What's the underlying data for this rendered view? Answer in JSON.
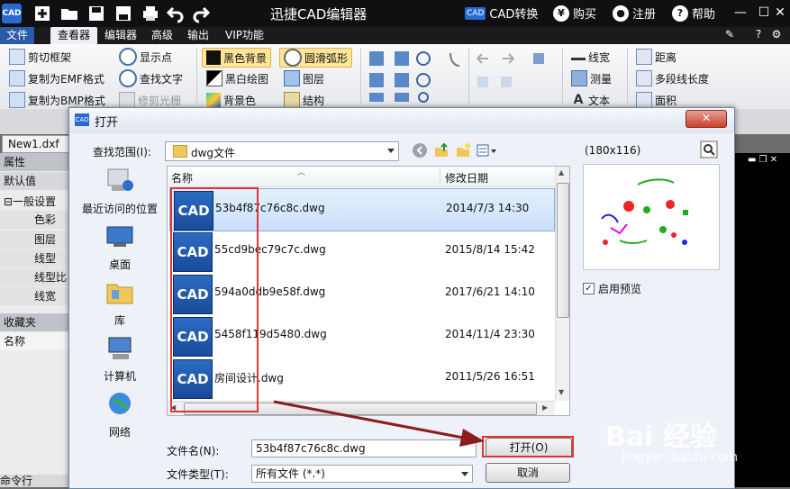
{
  "app": {
    "title": "迅捷CAD编辑器",
    "logo_text": "CAD",
    "top_buttons": [
      {
        "label": "CAD转换",
        "icon": "cad-convert-icon"
      },
      {
        "label": "购买",
        "icon": "yen-icon"
      },
      {
        "label": "注册",
        "icon": "user-icon"
      },
      {
        "label": "帮助",
        "icon": "help-icon"
      }
    ]
  },
  "menu": {
    "items": [
      "文件",
      "查看器",
      "编辑器",
      "高级",
      "输出",
      "VIP功能"
    ],
    "active": "查看器"
  },
  "ribbon": {
    "col1": [
      "剪切框架",
      "复制为EMF格式",
      "复制为BMP格式"
    ],
    "col2": [
      "显示点",
      "查找文字",
      "修剪光栅"
    ],
    "col3": [
      "黑色背景",
      "黑白绘图",
      "背景色"
    ],
    "col4": [
      "圆滑弧形",
      "图层",
      "结构"
    ],
    "col5": [
      "线宽",
      "测量",
      "文本"
    ],
    "col6": [
      "距离",
      "多段线长度",
      "面积"
    ]
  },
  "left_panel": {
    "doc_tab": "New1.dxf",
    "properties_title": "属性",
    "default_value": "默认值",
    "group": "一般设置",
    "props": [
      "色彩",
      "图层",
      "线型",
      "线型比",
      "线宽"
    ],
    "favorites": "收藏夹",
    "name_col": "名称",
    "command_line": "命令行"
  },
  "dialog": {
    "title": "打开",
    "lookin_label": "查找范围(I):",
    "lookin_value": "dwg文件",
    "places": [
      "最近访问的位置",
      "桌面",
      "库",
      "计算机",
      "网络"
    ],
    "col_name": "名称",
    "col_date": "修改日期",
    "files": [
      {
        "name": "53b4f87c76c8c.dwg",
        "date": "2014/7/3 14:30",
        "selected": true
      },
      {
        "name": "55cd9bec79c7c.dwg",
        "date": "2015/8/14 15:42",
        "selected": false
      },
      {
        "name": "594a0ddb9e58f.dwg",
        "date": "2017/6/21 14:10",
        "selected": false
      },
      {
        "name": "5458f119d5480.dwg",
        "date": "2014/11/4 23:30",
        "selected": false
      },
      {
        "name": "房间设计.dwg",
        "date": "2011/5/26 16:51",
        "selected": false
      }
    ],
    "file_icon_text": "CAD",
    "preview_size": "(180x116)",
    "preview_checkbox": "启用预览",
    "filename_label": "文件名(N):",
    "filename_value": "53b4f87c76c8c.dwg",
    "filetype_label": "文件类型(T):",
    "filetype_value": "所有文件 (*.*)",
    "open_button": "打开(O)",
    "cancel_button": "取消"
  },
  "watermark": {
    "line1": "Bai 经验",
    "line2": "jingyan.baidu.com"
  },
  "colors": {
    "accent": "#2a5aa8",
    "highlight": "#e23636",
    "selected_row": "#c9e0f9"
  }
}
